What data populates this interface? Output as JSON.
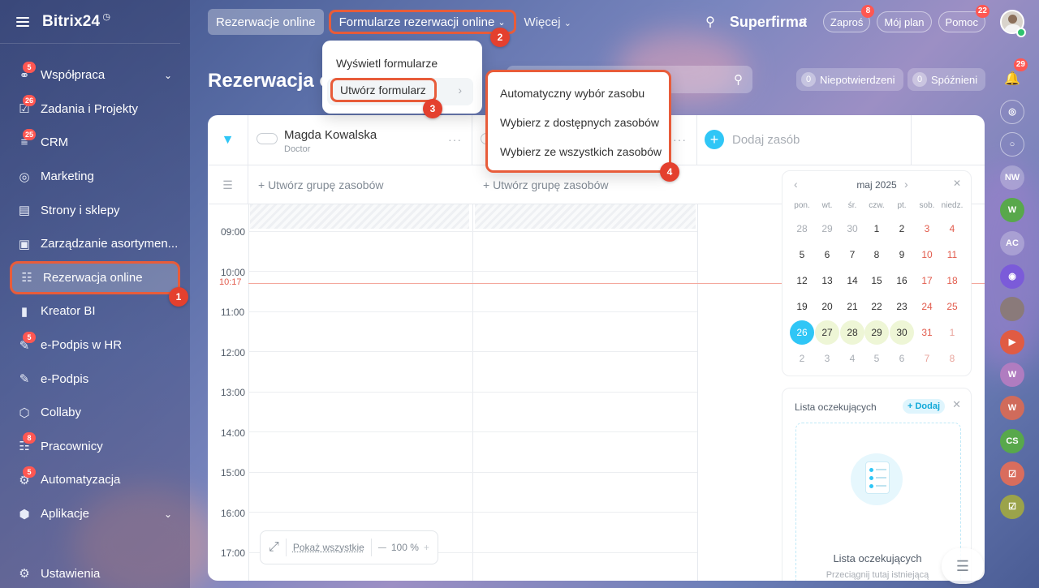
{
  "sidebar": {
    "logo": "Bitrix24",
    "items": [
      {
        "label": "Współpraca",
        "badge": "5",
        "chevron": true
      },
      {
        "label": "Zadania i Projekty",
        "badge": "26"
      },
      {
        "label": "CRM",
        "badge": "25"
      },
      {
        "label": "Marketing",
        "badge": ""
      },
      {
        "label": "Strony i sklepy",
        "badge": ""
      },
      {
        "label": "Zarządzanie asortymen...",
        "badge": ""
      },
      {
        "label": "Rezerwacja online",
        "badge": "",
        "active": true
      },
      {
        "label": "Kreator BI",
        "badge": ""
      },
      {
        "label": "e-Podpis w HR",
        "badge": "5"
      },
      {
        "label": "e-Podpis",
        "badge": ""
      },
      {
        "label": "Collaby",
        "badge": ""
      },
      {
        "label": "Pracownicy",
        "badge": "8"
      },
      {
        "label": "Automatyzacja",
        "badge": "5"
      },
      {
        "label": "Aplikacje",
        "badge": "",
        "chevron": true
      }
    ],
    "settings_label": "Ustawienia"
  },
  "topbar": {
    "tab_booking": "Rezerwacje online",
    "tab_forms": "Formularze rezerwacji online",
    "more": "Więcej",
    "company": "Superfirma",
    "invite": "Zaproś",
    "invite_badge": "8",
    "my_plan": "Mój plan",
    "help": "Pomoc",
    "help_badge": "22"
  },
  "page": {
    "title": "Rezerwacja o",
    "unconfirmed_count": "0",
    "unconfirmed_label": "Niepotwierdzeni",
    "late_count": "0",
    "late_label": "Spóźnieni"
  },
  "resources": {
    "resource1_name": "Magda Kowalska",
    "resource1_role": "Doctor",
    "add_resource": "Dodaj zasób",
    "create_group": "+ Utwórz grupę zasobów",
    "create_group2": "+ Utwórz grupę zasobów"
  },
  "schedule": {
    "hours": [
      "09:00",
      "10:00",
      "11:00",
      "12:00",
      "13:00",
      "14:00",
      "15:00",
      "16:00",
      "17:00"
    ],
    "now": "10:17"
  },
  "zoom": {
    "show_all": "Pokaż wszystkie",
    "minus": "—",
    "level": "100 %",
    "plus": "+"
  },
  "calendar": {
    "month": "maj 2025",
    "weekdays": [
      "pon.",
      "wt.",
      "śr.",
      "czw.",
      "pt.",
      "sob.",
      "niedz."
    ],
    "weeks": [
      [
        "28",
        "29",
        "30",
        "1",
        "2",
        "3",
        "4"
      ],
      [
        "5",
        "6",
        "7",
        "8",
        "9",
        "10",
        "11"
      ],
      [
        "12",
        "13",
        "14",
        "15",
        "16",
        "17",
        "18"
      ],
      [
        "19",
        "20",
        "21",
        "22",
        "23",
        "24",
        "25"
      ],
      [
        "26",
        "27",
        "28",
        "29",
        "30",
        "31",
        "1"
      ],
      [
        "2",
        "3",
        "4",
        "5",
        "6",
        "7",
        "8"
      ]
    ],
    "today": "26"
  },
  "waitlist": {
    "title": "Lista oczekujących",
    "add": "+ Dodaj",
    "empty_title": "Lista oczekujących",
    "empty_sub": "Przeciągnij tutaj istniejącą"
  },
  "menu_forms": {
    "show_forms": "Wyświetl formularze",
    "create_form": "Utwórz formularz"
  },
  "menu_create": {
    "auto": "Automatyczny wybór zasobu",
    "from_available": "Wybierz z dostępnych zasobów",
    "from_all": "Wybierz ze wszystkich zasobów"
  },
  "steps": [
    "1",
    "2",
    "3",
    "4"
  ],
  "right_strip": {
    "notif_badge": "29",
    "avatars": [
      "NW",
      "W",
      "AC",
      "",
      "",
      "",
      "W",
      "W",
      "CS",
      "",
      ""
    ]
  }
}
